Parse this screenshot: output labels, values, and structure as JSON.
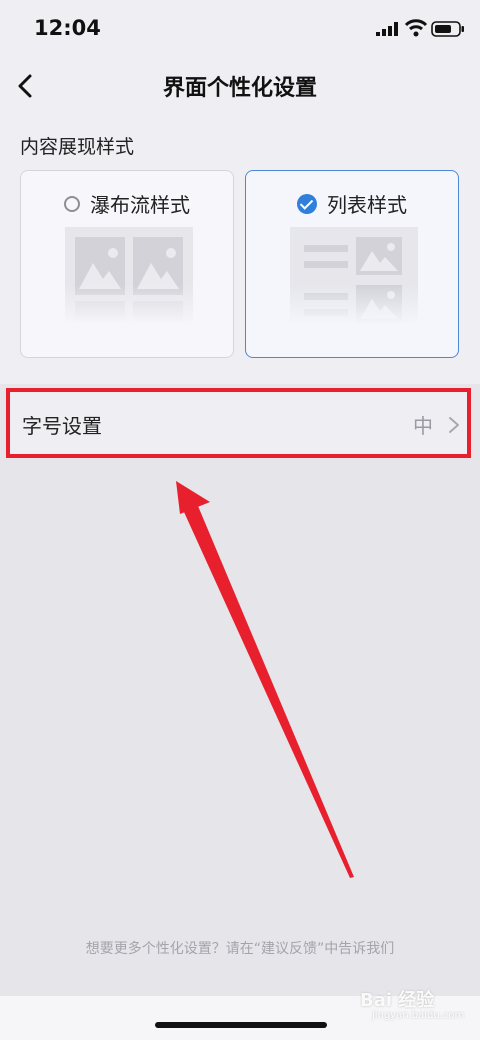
{
  "status_bar": {
    "time": "12:04"
  },
  "nav": {
    "title": "界面个性化设置"
  },
  "content_style": {
    "section_title": "内容展现样式",
    "options": [
      {
        "label": "瀑布流样式",
        "selected": false,
        "icon": "waterfall-preview-icon"
      },
      {
        "label": "列表样式",
        "selected": true,
        "icon": "list-preview-icon"
      }
    ]
  },
  "font_setting": {
    "label": "字号设置",
    "value": "中"
  },
  "footer": {
    "note": "想要更多个性化设置？请在“建议反馈”中告诉我们"
  },
  "watermark": {
    "text": "Bai 经验",
    "url": "jingyan.baidu.com"
  },
  "colors": {
    "accent": "#2f7fdb",
    "highlight": "#e8202e",
    "background": "#e6e5ea"
  }
}
